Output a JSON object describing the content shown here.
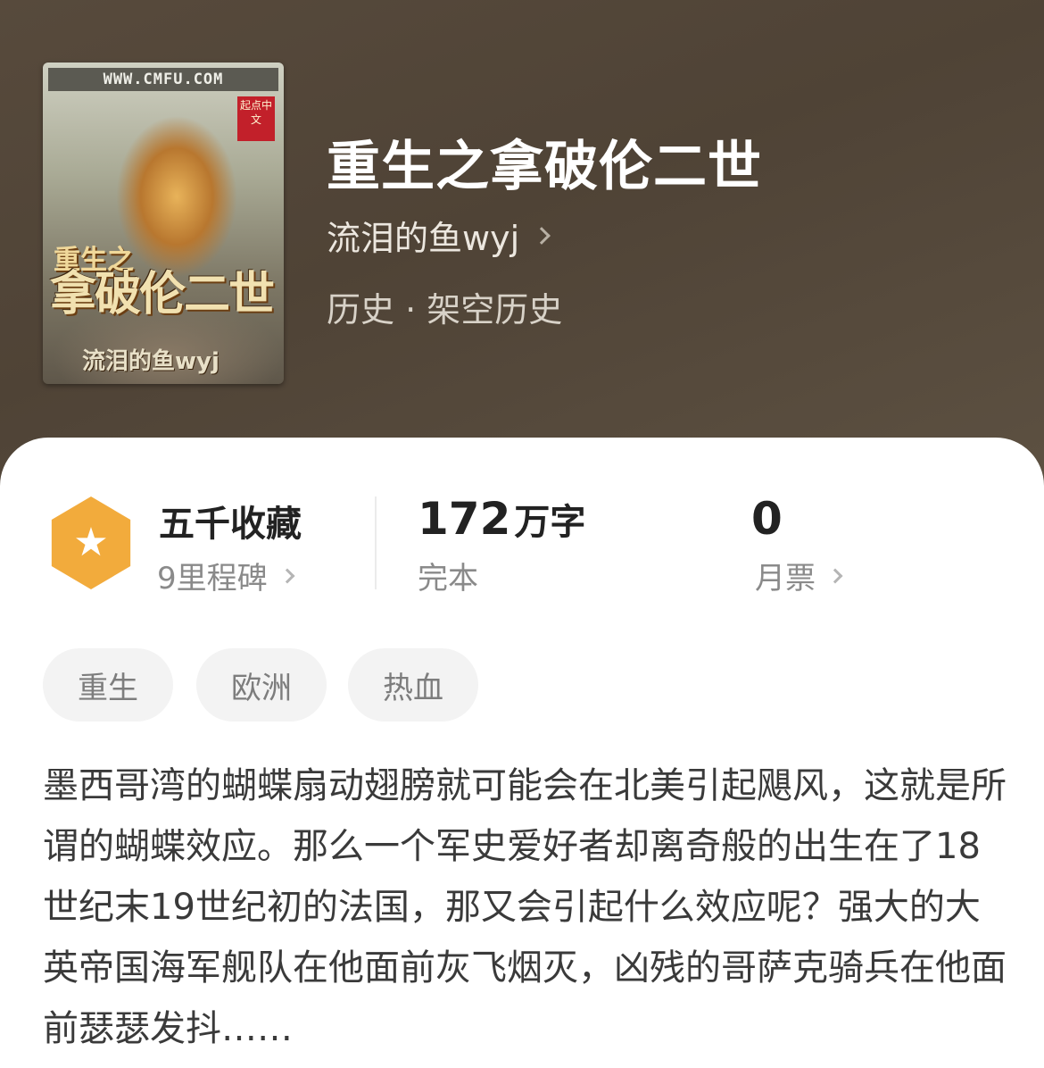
{
  "book": {
    "cover": {
      "url_text": "WWW.CMFU.COM",
      "badge_text": "起点中文",
      "title_small": "重生之",
      "title_big": "拿破伦二世",
      "author": "流泪的鱼wyj"
    },
    "title": "重生之拿破伦二世",
    "author": "流泪的鱼wyj",
    "genre": "历史 · 架空历史"
  },
  "stats": {
    "collection": {
      "main": "五千收藏",
      "sub": "9里程碑"
    },
    "words": {
      "number": "172",
      "unit": "万字",
      "sub": "完本"
    },
    "monthly": {
      "main": "0",
      "sub": "月票"
    }
  },
  "tags": [
    "重生",
    "欧洲",
    "热血"
  ],
  "description": "墨西哥湾的蝴蝶扇动翅膀就可能会在北美引起飓风，这就是所谓的蝴蝶效应。那么一个军史爱好者却离奇般的出生在了18世纪末19世纪初的法国，那又会引起什么效应呢？强大的大英帝国海军舰队在他面前灰飞烟灭，凶残的哥萨克骑兵在他面前瑟瑟发抖……",
  "colors": {
    "header_bg": "#574a3c",
    "badge": "#f2ab3c",
    "tag_bg": "#f3f3f3"
  },
  "icons": [
    "star-icon",
    "chevron-right-icon"
  ]
}
